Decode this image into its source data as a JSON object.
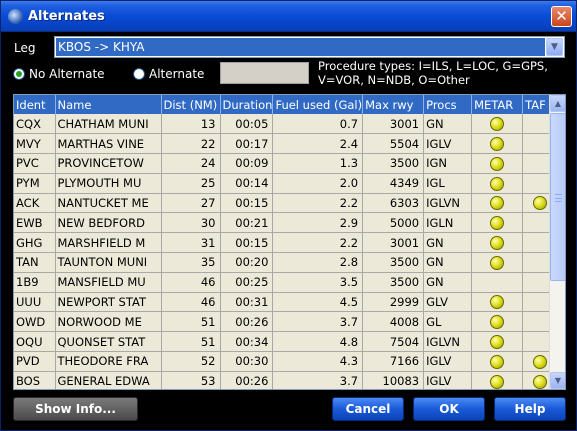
{
  "window": {
    "title": "Alternates"
  },
  "leg": {
    "label": "Leg",
    "value": "KBOS -> KHYA"
  },
  "options": {
    "no_alternate": "No Alternate",
    "alternate": "Alternate",
    "selected": "no_alternate"
  },
  "procedure_note": "Procedure types: I=ILS, L=LOC, G=GPS, V=VOR, N=NDB, O=Other",
  "table": {
    "columns": [
      "Ident",
      "Name",
      "Dist (NM)",
      "Duration",
      "Fuel used (Gal)",
      "Max rwy",
      "Procs",
      "METAR",
      "TAF"
    ],
    "rows": [
      {
        "ident": "CQX",
        "name": "CHATHAM MUNI",
        "dist": "13",
        "duration": "00:05",
        "fuel": "0.7",
        "maxrwy": "3001",
        "procs": "GN",
        "metar": true,
        "taf": false
      },
      {
        "ident": "MVY",
        "name": "MARTHAS VINE",
        "dist": "22",
        "duration": "00:17",
        "fuel": "2.4",
        "maxrwy": "5504",
        "procs": "IGLV",
        "metar": true,
        "taf": false
      },
      {
        "ident": "PVC",
        "name": "PROVINCETOW",
        "dist": "24",
        "duration": "00:09",
        "fuel": "1.3",
        "maxrwy": "3500",
        "procs": "IGN",
        "metar": true,
        "taf": false
      },
      {
        "ident": "PYM",
        "name": "PLYMOUTH MU",
        "dist": "25",
        "duration": "00:14",
        "fuel": "2.0",
        "maxrwy": "4349",
        "procs": "IGL",
        "metar": true,
        "taf": false
      },
      {
        "ident": "ACK",
        "name": "NANTUCKET ME",
        "dist": "27",
        "duration": "00:15",
        "fuel": "2.2",
        "maxrwy": "6303",
        "procs": "IGLVN",
        "metar": true,
        "taf": true
      },
      {
        "ident": "EWB",
        "name": "NEW BEDFORD",
        "dist": "30",
        "duration": "00:21",
        "fuel": "2.9",
        "maxrwy": "5000",
        "procs": "IGLN",
        "metar": true,
        "taf": false
      },
      {
        "ident": "GHG",
        "name": "MARSHFIELD M",
        "dist": "31",
        "duration": "00:15",
        "fuel": "2.2",
        "maxrwy": "3001",
        "procs": "GN",
        "metar": true,
        "taf": false
      },
      {
        "ident": "TAN",
        "name": "TAUNTON MUNI",
        "dist": "35",
        "duration": "00:20",
        "fuel": "2.8",
        "maxrwy": "3500",
        "procs": "GN",
        "metar": true,
        "taf": false
      },
      {
        "ident": "1B9",
        "name": "MANSFIELD MU",
        "dist": "46",
        "duration": "00:25",
        "fuel": "3.5",
        "maxrwy": "3500",
        "procs": "GN",
        "metar": false,
        "taf": false
      },
      {
        "ident": "UUU",
        "name": "NEWPORT STAT",
        "dist": "46",
        "duration": "00:31",
        "fuel": "4.5",
        "maxrwy": "2999",
        "procs": "GLV",
        "metar": true,
        "taf": false
      },
      {
        "ident": "OWD",
        "name": "NORWOOD ME",
        "dist": "51",
        "duration": "00:26",
        "fuel": "3.7",
        "maxrwy": "4008",
        "procs": "GL",
        "metar": true,
        "taf": false
      },
      {
        "ident": "OQU",
        "name": "QUONSET STAT",
        "dist": "51",
        "duration": "00:34",
        "fuel": "4.8",
        "maxrwy": "7504",
        "procs": "IGLVN",
        "metar": true,
        "taf": false
      },
      {
        "ident": "PVD",
        "name": "THEODORE FRA",
        "dist": "52",
        "duration": "00:30",
        "fuel": "4.3",
        "maxrwy": "7166",
        "procs": "IGLV",
        "metar": true,
        "taf": true
      },
      {
        "ident": "BOS",
        "name": "GENERAL EDWA",
        "dist": "53",
        "duration": "00:26",
        "fuel": "3.7",
        "maxrwy": "10083",
        "procs": "IGLV",
        "metar": true,
        "taf": true
      }
    ]
  },
  "buttons": {
    "show_info": "Show Info...",
    "cancel": "Cancel",
    "ok": "OK",
    "help": "Help"
  },
  "colors": {
    "title_bar": "#0a4bd6",
    "selection": "#316ac5",
    "row_bg": "#ece9d8",
    "indicator": "#e0e020"
  }
}
